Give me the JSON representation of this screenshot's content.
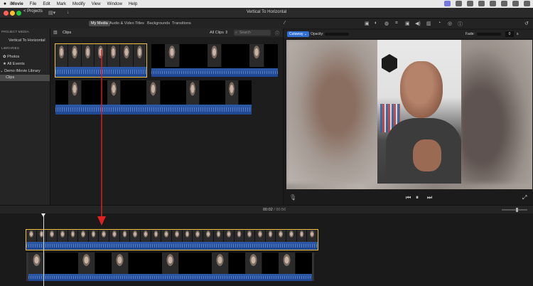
{
  "menubar": {
    "apple": "",
    "app_name": "iMovie",
    "items": [
      "File",
      "Edit",
      "Mark",
      "Modify",
      "View",
      "Window",
      "Help"
    ]
  },
  "titlebar": {
    "projects_button": "< Projects",
    "title": "Vertical To Horizontal"
  },
  "toolbar": {
    "tabs": [
      "My Media",
      "Audio & Video",
      "Titles",
      "Backgrounds",
      "Transitions"
    ],
    "active_tab": "My Media"
  },
  "sidebar": {
    "project_media_header": "PROJECT MEDIA",
    "project_item": "Vertical To Horizontal",
    "libraries_header": "LIBRARIES",
    "items": [
      "Photos",
      "All Events",
      "Demo iMovie Library",
      "Clips"
    ],
    "selected": "Clips"
  },
  "browser": {
    "title": "Clips",
    "filter": "All Clips",
    "search_placeholder": "Search"
  },
  "viewer": {
    "overlay_mode": "Cutaway",
    "opacity_label": "Opacity:",
    "fade_label": "Fade:",
    "fade_value": "0",
    "fade_unit": "s"
  },
  "timeline": {
    "current_time": "00:02",
    "separator": "/",
    "duration": "00:56",
    "zoom_level": 0.58
  },
  "colors": {
    "accent": "#2f6fd6",
    "audio_wave": "#2d5aa8",
    "annotation_arrow": "#e02020",
    "selection": "#f0c040"
  }
}
